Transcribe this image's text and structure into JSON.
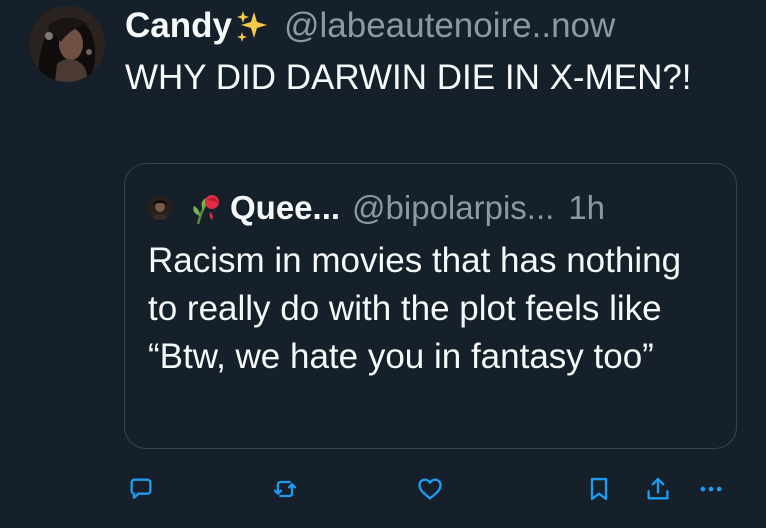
{
  "tweet": {
    "display_name": "Candy",
    "name_emoji_icon": "sparkles-icon",
    "handle": "@labeautenoire..",
    "time": "now",
    "text": "WHY DID DARWIN DIE IN X-MEN?!"
  },
  "quote": {
    "name_emoji_icon": "wilted-rose-icon",
    "display_name": "Quee...",
    "handle": "@bipolarpis...",
    "time": "1h",
    "text": "Racism in movies that has nothing to really do with the plot feels like “Btw, we hate you in fantasy too”"
  },
  "actions": {
    "reply_icon": "reply-icon",
    "retweet_icon": "retweet-icon",
    "like_icon": "heart-icon",
    "bookmark_icon": "bookmark-icon",
    "share_icon": "share-icon",
    "more_icon": "more-icon"
  },
  "colors": {
    "background": "#15202b",
    "text": "#f7f9f9",
    "secondary_text": "#8b98a5",
    "border": "#38444d",
    "accent": "#1d9bf0"
  }
}
